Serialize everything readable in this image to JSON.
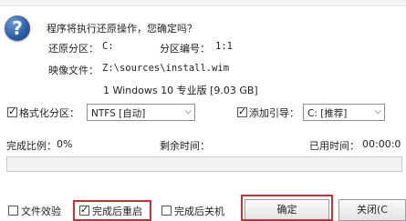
{
  "dialog": {
    "message": "程序将执行还原操作，您确定吗？",
    "restore_partition_label": "还原分区：",
    "restore_partition_value": "C:",
    "partition_number_label": "分区编号：",
    "partition_number_value": "1:1",
    "image_file_label": "映像文件：",
    "image_file_value": "Z:\\sources\\install.wim",
    "image_info": "1 Windows 10 专业版 [9.03 GB]"
  },
  "options": {
    "format_label": "格式化分区：",
    "format_value": "NTFS [自动]",
    "boot_label": "添加引导：",
    "boot_value": "C: [推荐]"
  },
  "progress": {
    "ratio_label": "完成比例：",
    "ratio_value": "0%",
    "remaining_label": "剩余时间：",
    "remaining_value": "",
    "elapsed_label": "已用时间：",
    "elapsed_value": "00:00:0",
    "fraction": 0
  },
  "footer": {
    "verify_label": "文件效验",
    "reboot_label": "完成后重启",
    "shutdown_label": "完成后关机",
    "ok_label": "确定",
    "close_label": "关闭(C"
  },
  "checks": {
    "format": true,
    "boot": true,
    "verify": false,
    "reboot": true,
    "shutdown": false
  },
  "colors": {
    "highlight": "#c9313a",
    "icon": "#2e5fa8"
  }
}
